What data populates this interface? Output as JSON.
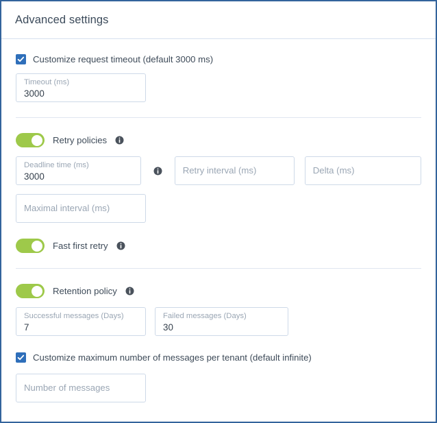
{
  "header": {
    "title": "Advanced settings"
  },
  "timeout_section": {
    "checkbox_label": "Customize request timeout (default 3000 ms)",
    "checked": true,
    "field": {
      "label": "Timeout (ms)",
      "value": "3000"
    }
  },
  "retry_section": {
    "toggle_label": "Retry policies",
    "toggle_on": true,
    "info_icon": "info-icon",
    "deadline_field": {
      "label": "Deadline time (ms)",
      "value": "3000"
    },
    "deadline_info_icon": "info-icon",
    "retry_interval_field": {
      "placeholder": "Retry interval (ms)"
    },
    "delta_field": {
      "placeholder": "Delta (ms)"
    },
    "maximal_interval_field": {
      "placeholder": "Maximal interval (ms)"
    },
    "fast_first_retry": {
      "toggle_label": "Fast first retry",
      "toggle_on": true,
      "info_icon": "info-icon"
    }
  },
  "retention_section": {
    "toggle_label": "Retention policy",
    "toggle_on": true,
    "info_icon": "info-icon",
    "successful_field": {
      "label": "Successful messages (Days)",
      "value": "7"
    },
    "failed_field": {
      "label": "Failed messages (Days)",
      "value": "30"
    },
    "max_messages_checkbox_label": "Customize maximum number of messages per tenant (default infinite)",
    "max_messages_checked": true,
    "number_of_messages_field": {
      "placeholder": "Number of messages"
    }
  },
  "colors": {
    "panel_border": "#33649c",
    "toggle_on": "#9ec94a",
    "checkbox_checked": "#2f6fba",
    "field_border": "#cdd9e8",
    "divider": "#dfe6f0",
    "title_text": "#3b4a5a",
    "label_text": "#3e4b59",
    "placeholder_text": "#9aa6b4",
    "info_icon": "#4a525c"
  }
}
